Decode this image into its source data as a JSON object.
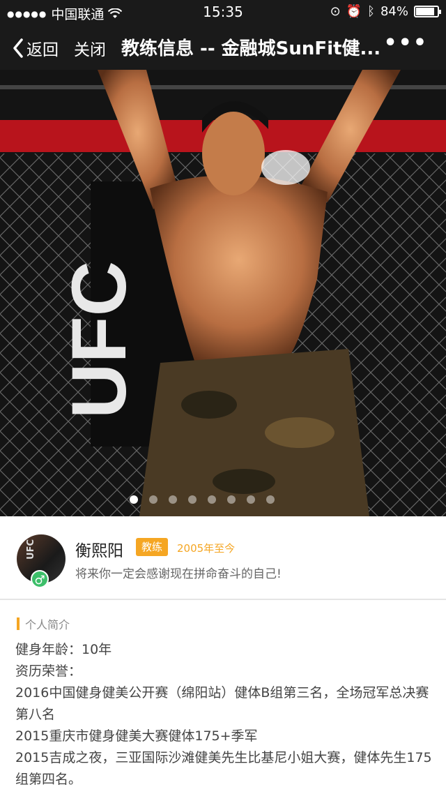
{
  "status_bar": {
    "carrier": "中国联通",
    "time": "15:35",
    "battery": "84%"
  },
  "nav": {
    "back_label": "返回",
    "close_label": "关闭",
    "title": "教练信息 -- 金融城SunFit健...",
    "more_label": "•••"
  },
  "carousel": {
    "slide_count": 8,
    "active_index": 0
  },
  "coach": {
    "name": "衡熙阳",
    "tag": "教练",
    "since": "2005年至今",
    "motto": "将来你一定会感谢现在拼命奋斗的自己!",
    "gender_symbol": "♂"
  },
  "intro": {
    "title": "个人简介",
    "lines": [
      "健身年龄：10年",
      "资历荣誉：",
      "2016中国健身健美公开赛（绵阳站）健体B组第三名，全场冠军总决赛第八名",
      "2015重庆市健身健美大赛健体175+季军",
      "2015吉成之夜，三亚国际沙滩健美先生比基尼小姐大赛，健体先生175组第四名。"
    ]
  },
  "colors": {
    "accent": "#f5a623",
    "gender_badge": "#3dbf6a",
    "bar_bg": "#1a1a1a"
  }
}
